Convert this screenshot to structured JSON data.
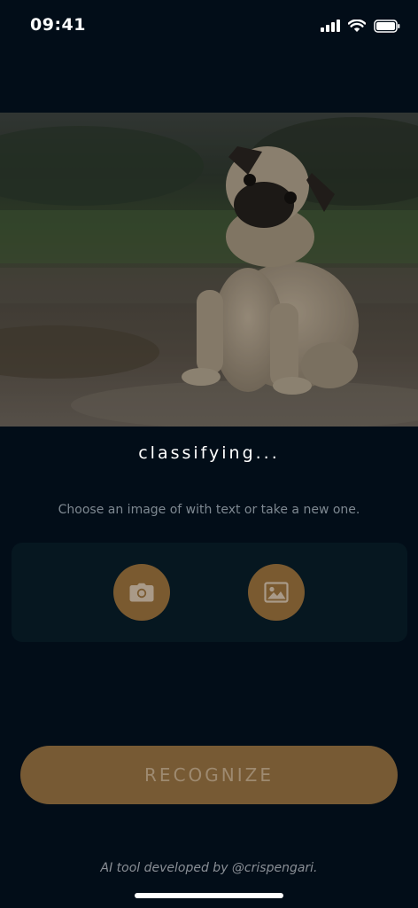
{
  "status_bar": {
    "time": "09:41"
  },
  "photo": {
    "subject": "pug puppy sitting on gravel path"
  },
  "classification": {
    "status": "classifying..."
  },
  "hint": "Choose an image of with text or take a new one.",
  "picker": {
    "camera_icon": "camera-icon",
    "gallery_icon": "image-gallery-icon"
  },
  "actions": {
    "recognize_label": "RECOGNIZE"
  },
  "footer": {
    "credit": "AI tool developed by @crispengari."
  },
  "colors": {
    "background": "#020d18",
    "accent": "#7a5a30",
    "card": "#061720"
  }
}
